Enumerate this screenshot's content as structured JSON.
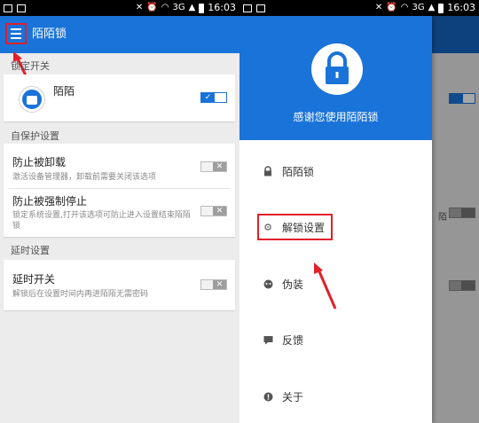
{
  "status_bar": {
    "network": "3G",
    "time": "16:03"
  },
  "left_screen": {
    "app_title": "陌陌锁",
    "sections": {
      "lock_switch": "锁定开关",
      "self_protect": "自保护设置",
      "delay": "延时设置"
    },
    "app_row": {
      "name": "陌陌"
    },
    "prevent_uninstall": {
      "title": "防止被卸载",
      "desc": "激活设备管理器，卸载前需要关闭该选项"
    },
    "prevent_force_stop": {
      "title": "防止被强制停止",
      "desc": "锁定系统设置,打开该选项可防止进入设置结束陌陌锁"
    },
    "delay_switch": {
      "title": "延时开关",
      "desc": "解锁后在设置时间内再进陌陌无需密码"
    }
  },
  "right_screen": {
    "drawer_header_text": "感谢您使用陌陌锁",
    "menu_items": [
      {
        "label": "陌陌锁",
        "icon": "lock-icon"
      },
      {
        "label": "解锁设置",
        "icon": "gear-icon"
      },
      {
        "label": "伪装",
        "icon": "mask-icon"
      },
      {
        "label": "反馈",
        "icon": "chat-bubble-icon"
      },
      {
        "label": "关于",
        "icon": "info-icon"
      }
    ],
    "peek_text": "陌"
  },
  "colors": {
    "primary": "#1a73d9",
    "highlight": "#e0202a",
    "background": "#ececec"
  }
}
